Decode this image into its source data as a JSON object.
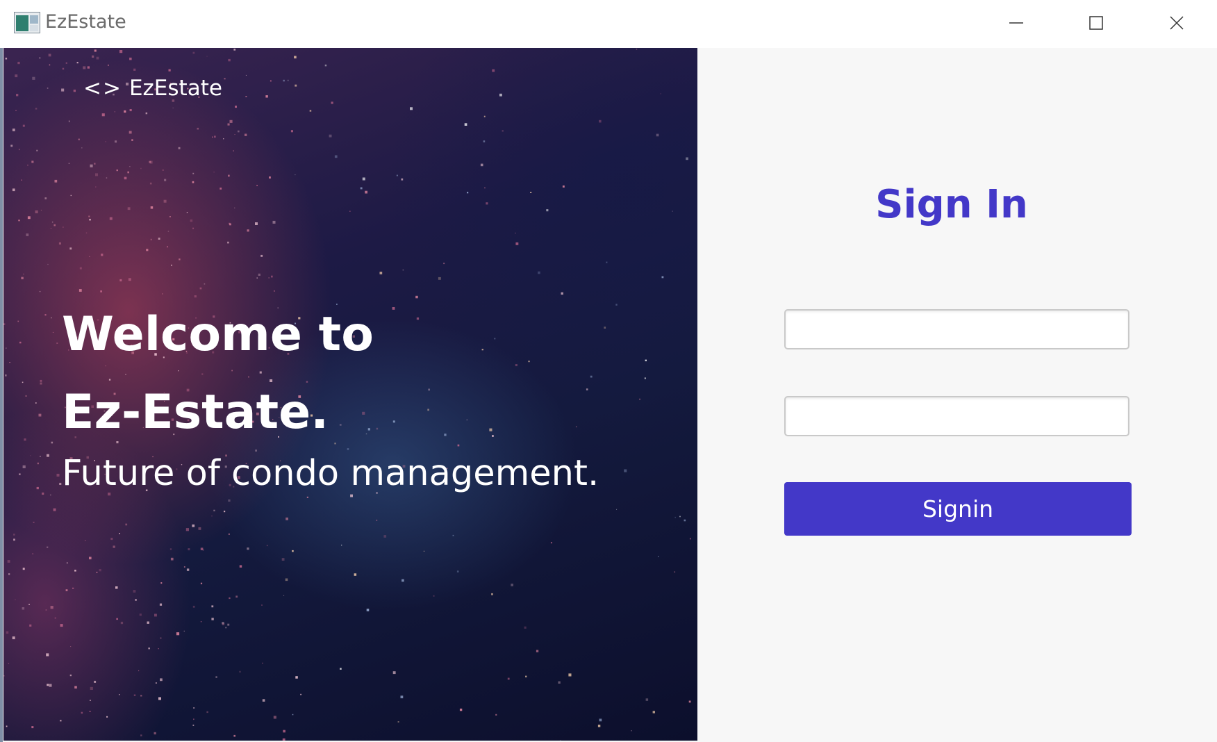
{
  "window": {
    "title": "EzEstate",
    "controls": {
      "minimize_icon": "minimize-icon",
      "maximize_icon": "maximize-icon",
      "close_icon": "close-icon"
    }
  },
  "hero": {
    "brand_icon": "<>",
    "brand_name": "EzEstate",
    "welcome_line1": "Welcome to",
    "welcome_line2": "Ez-Estate.",
    "tagline": "Future of condo management."
  },
  "signin": {
    "title": "Sign In",
    "username_value": "",
    "password_value": "",
    "button_label": "Signin"
  },
  "colors": {
    "accent": "#4338c8",
    "panel_background": "#f7f7f7",
    "hero_text": "#ffffff"
  }
}
